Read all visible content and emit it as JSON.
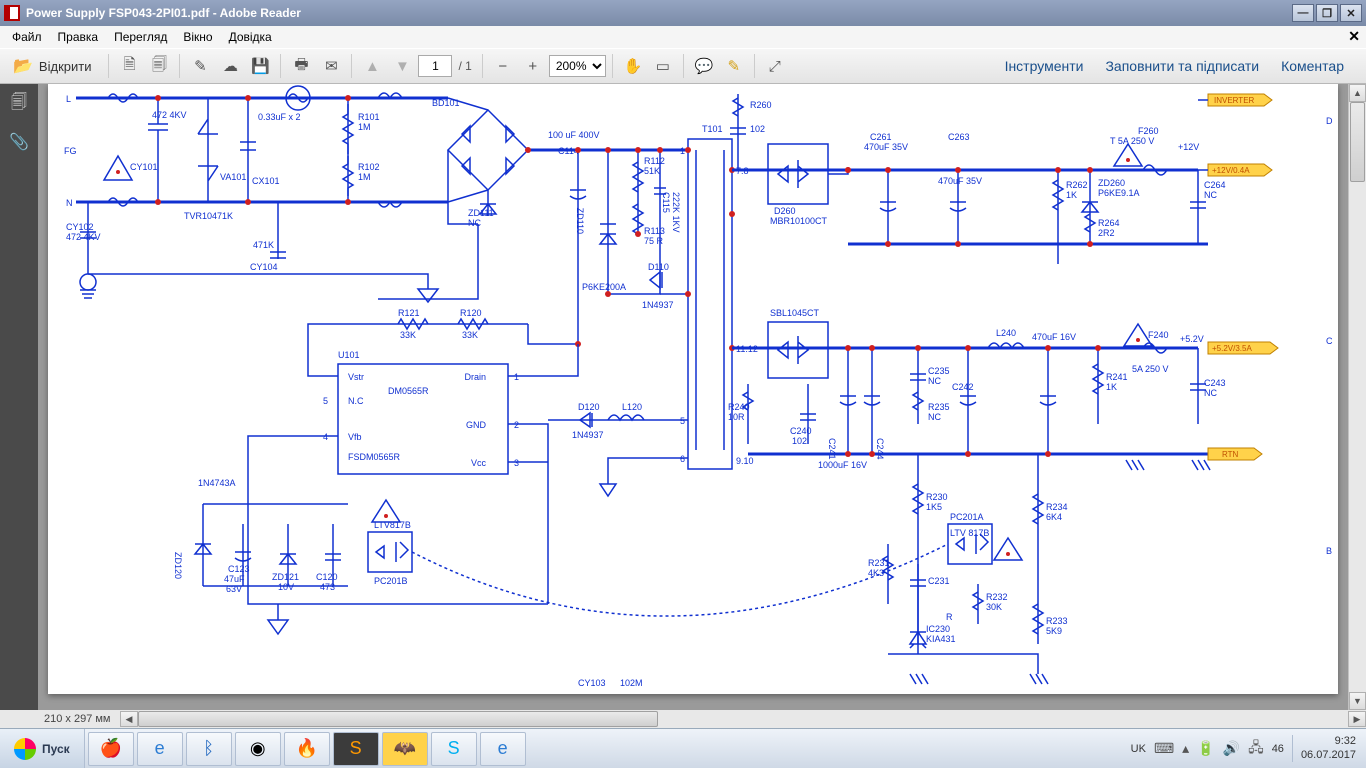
{
  "titlebar": {
    "title": "Power Supply FSP043-2PI01.pdf - Adobe Reader"
  },
  "menu": {
    "file": "Файл",
    "edit": "Правка",
    "view": "Перегляд",
    "window": "Вікно",
    "help": "Довідка"
  },
  "toolbar": {
    "open": "Відкрити",
    "page_current": "1",
    "page_total": "/ 1",
    "zoom": "200%",
    "tools": "Інструменти",
    "fillsign": "Заповнити та підписати",
    "comment": "Коментар"
  },
  "status": {
    "page_dims": "210 x 297 мм"
  },
  "taskbar": {
    "start": "Пуск",
    "lang": "UK",
    "battery": "46",
    "time": "9:32",
    "date": "06.07.2017"
  },
  "schematic": {
    "connectors": {
      "inverter": "INVERTER",
      "p12v": "+12V/0.4A",
      "p5v": "+5.2V/3.5A",
      "rtn": "RTN"
    },
    "labels": {
      "L": "L",
      "N": "N",
      "FG": "FG",
      "cap_472_4kv": "472 4KV",
      "CY101": "CY101",
      "CY102": "CY102",
      "cap_472_4kv2": "472 4KV",
      "CX101": "0.33uF x 2",
      "CX101n": "CX101",
      "VA101": "VA101",
      "TVR": "TVR10471K",
      "R101": "R101",
      "R101v": "1M",
      "R102": "R102",
      "R102v": "1M",
      "CY104": "CY104",
      "CY104v": "471K",
      "BD101": "BD101",
      "ZD111": "ZD111",
      "ZD111v": "NC",
      "C114": "C114",
      "C114v": "100 uF 400V",
      "R112": "R112",
      "R112v": "51K",
      "R113": "R113",
      "R113v": "75 R",
      "C115": "C115",
      "C115v": "222K 1KV",
      "ZD110": "ZD110",
      "P6KE": "P6KE200A",
      "D110": "D110",
      "D110v": "1N4937",
      "T101": "T101",
      "t_1": "1",
      "t_78": "7.8",
      "t_1112": "11.12",
      "t_910": "9.10",
      "t_5": "5",
      "t_6": "6",
      "R121": "R121",
      "R121v": "33K",
      "R120": "R120",
      "R120v": "33K",
      "U101": "U101",
      "ic_Vstr": "Vstr",
      "ic_Drain": "Drain",
      "ic_NC": "N.C",
      "ic_GND": "GND",
      "ic_Vfb": "Vfb",
      "ic_Vcc": "Vcc",
      "ic_p1": "1",
      "ic_p2": "2",
      "ic_p3": "3",
      "ic_p4": "4",
      "ic_p5": "5",
      "DM0565R": "DM0565R",
      "FSDM0565R": "FSDM0565R",
      "ZD120": "ZD120",
      "ZD120v": "1N4743A",
      "C123": "C123",
      "C123v": "47uF",
      "C123v2": "63V",
      "ZD121": "ZD121",
      "ZD121v": "10V",
      "C120": "C120",
      "C120v": "473",
      "PC201B": "PC201B",
      "LTV817B": "LTV817B",
      "D120": "D120",
      "D120v": "1N4937",
      "L120": "L120",
      "CY103": "CY103",
      "CY103v": "102M",
      "R260": "R260",
      "cap_102": "102",
      "D260": "D260",
      "D260v": "MBR10100CT",
      "C261": "C261",
      "C261v": "470uF 35V",
      "C263": "C263",
      "C263v": "470uF 35V",
      "R262": "R262",
      "R262v": "1K",
      "ZD260": "ZD260",
      "ZD260v": "P6KE9.1A",
      "R264": "R264",
      "R264v": "2R2",
      "F260": "F260",
      "F260v": "T 5A 250 V",
      "v12": "+12V",
      "C264": "C264",
      "C264v": "NC",
      "SBL": "SBL1045CT",
      "R240": "R240",
      "R240v": "10R",
      "C240": "C240",
      "C240v": "102",
      "C241": "C241",
      "C244": "C244",
      "c1000": "1000uF 16V",
      "C235": "C235",
      "C235v": "NC",
      "R235": "R235",
      "R235v": "NC",
      "C242": "C242",
      "L240": "L240",
      "c470_16": "470uF 16V",
      "R241": "R241",
      "R241v": "1K",
      "F240": "F240",
      "F240v": "5A 250 V",
      "v52": "+5.2V",
      "C243": "C243",
      "C243v": "NC",
      "R230": "R230",
      "R230v": "1K5",
      "PC201A": "PC201A",
      "LTV817B2": "LTV 817B",
      "R231": "R231",
      "R231v": "4K3",
      "C231": "C231",
      "R232": "R232",
      "R232v": "30K",
      "R234": "R234",
      "R234v": "6K4",
      "IC230": "IC230",
      "KIA431": "KIA431",
      "R233": "R233",
      "R233v": "5K9",
      "R": "R",
      "zone_D": "D",
      "zone_C": "C",
      "zone_B": "B"
    }
  }
}
